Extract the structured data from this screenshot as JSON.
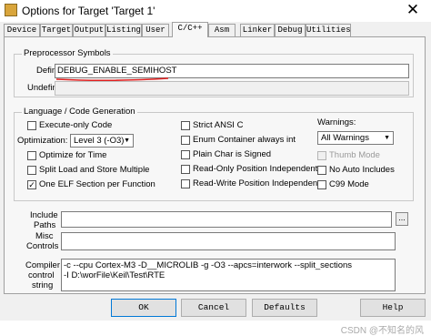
{
  "window": {
    "title": "Options for Target 'Target 1'",
    "close_glyph": "✕"
  },
  "tabs": [
    "Device",
    "Target",
    "Output",
    "Listing",
    "User",
    "C/C++",
    "Asm",
    "Linker",
    "Debug",
    "Utilities"
  ],
  "preprocessor": {
    "title": "Preprocessor Symbols",
    "define_label": "Define:",
    "define_value": "DEBUG_ENABLE_SEMIHOST",
    "undefine_label": "Undefine:",
    "undefine_value": ""
  },
  "language": {
    "title": "Language / Code Generation",
    "execute_only": "Execute-only Code",
    "optimization_label": "Optimization:",
    "optimization_value": "Level 3 (-O3)",
    "optimize_time": "Optimize for Time",
    "split_load": "Split Load and Store Multiple",
    "one_elf": "One ELF Section per Function",
    "strict_ansi": "Strict ANSI C",
    "enum_container": "Enum Container always int",
    "plain_char": "Plain Char is Signed",
    "ro_pi": "Read-Only Position Independent",
    "rw_pi": "Read-Write Position Independent",
    "warnings_label": "Warnings:",
    "warnings_value": "All Warnings",
    "thumb_mode": "Thumb Mode",
    "no_auto_includes": "No Auto Includes",
    "c99_mode": "C99 Mode",
    "checked": {
      "execute_only": false,
      "optimize_time": false,
      "split_load": false,
      "one_elf": true,
      "strict_ansi": false,
      "enum_container": false,
      "plain_char": false,
      "ro_pi": false,
      "rw_pi": false,
      "thumb_mode": false,
      "no_auto_includes": false,
      "c99_mode": false
    }
  },
  "include": {
    "label_line1": "Include",
    "label_line2": "Paths",
    "value": "",
    "browse": "..."
  },
  "misc": {
    "label_line1": "Misc",
    "label_line2": "Controls",
    "value": ""
  },
  "compiler": {
    "label_line1": "Compiler",
    "label_line2": "control",
    "label_line3": "string",
    "line1": "-c --cpu Cortex-M3 -D__MICROLIB -g -O3 --apcs=interwork --split_sections",
    "line2": "-I D:\\worFile\\Keil\\Test\\RTE"
  },
  "buttons": {
    "ok": "OK",
    "cancel": "Cancel",
    "defaults": "Defaults",
    "help": "Help"
  },
  "watermark": "CSDN @不知名的风",
  "colors": {
    "annotation_red": "#e02020",
    "default_button_border": "#0078d7"
  }
}
